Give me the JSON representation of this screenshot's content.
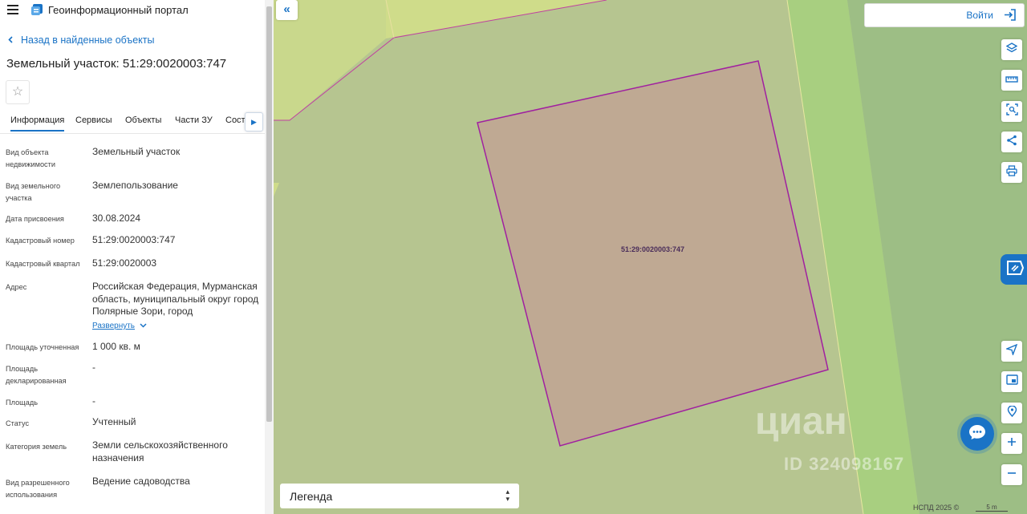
{
  "app": {
    "title": "Геоинформационный портал"
  },
  "nav": {
    "back_label": "Назад в найденные объекты"
  },
  "object": {
    "title": "Земельный участок: 51:29:0020003:747"
  },
  "tabs": [
    {
      "label": "Информация",
      "active": true
    },
    {
      "label": "Сервисы"
    },
    {
      "label": "Объекты"
    },
    {
      "label": "Части ЗУ"
    },
    {
      "label": "Соста"
    }
  ],
  "properties": [
    {
      "label": "Вид объекта недвижимости",
      "value": "Земельный участок"
    },
    {
      "label": "Вид земельного участка",
      "value": "Землепользование"
    },
    {
      "label": "Дата присвоения",
      "value": "30.08.2024"
    },
    {
      "label": "Кадастровый номер",
      "value": "51:29:0020003:747"
    },
    {
      "label": "Кадастровый квартал",
      "value": "51:29:0020003"
    },
    {
      "label": "Адрес",
      "value": "Российская Федерация, Мурманская область, муниципальный округ город Полярные Зори, город"
    },
    {
      "label": "Площадь уточненная",
      "value": "1 000 кв. м"
    },
    {
      "label": "Площадь декларированная",
      "value": "-"
    },
    {
      "label": "Площадь",
      "value": "-"
    },
    {
      "label": "Статус",
      "value": "Учтенный"
    },
    {
      "label": "Категория земель",
      "value": "Земли сельскохозяйственного назначения"
    },
    {
      "label": "Вид разрешенного использования",
      "value": "Ведение садоводства"
    }
  ],
  "address_expand_label": "Развернуть",
  "map": {
    "parcel_label": "51:29:0020003:747",
    "login_label": "Войти",
    "legend_label": "Легенда",
    "attribution": "НСПД 2025 ©",
    "scale_label": "5 m",
    "watermark": {
      "brand": "циан",
      "id_text": "ID 324098167"
    },
    "colors": {
      "parcel_fill": "#bfa993",
      "parcel_stroke": "#a020a0",
      "background": "#b6c590",
      "accent": "#1a73c6"
    }
  }
}
